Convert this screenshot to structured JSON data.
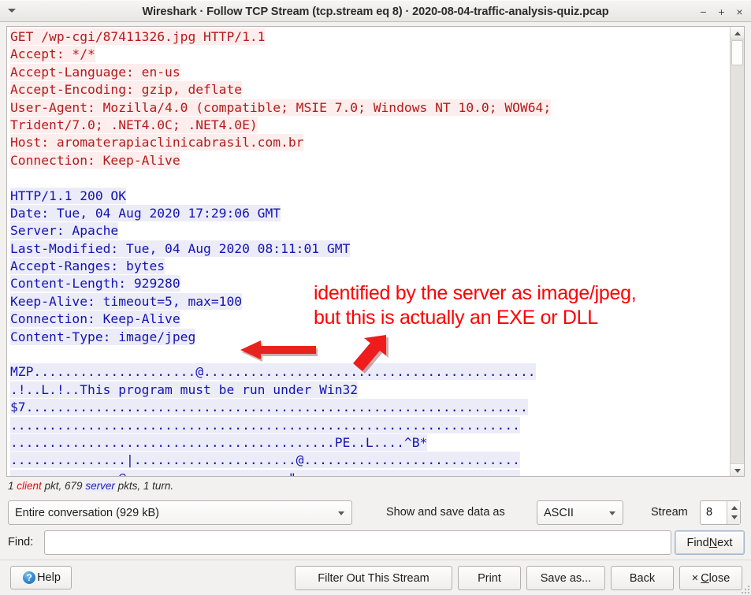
{
  "window": {
    "title": "Wireshark · Follow TCP Stream (tcp.stream eq 8) · 2020-08-04-traffic-analysis-quiz.pcap",
    "menu_arrow_icon": "chevron-down-icon",
    "minimize_label": "−",
    "maximize_label": "+",
    "close_label": "×"
  },
  "stream": {
    "lines": [
      {
        "dir": "client",
        "text": "GET /wp-cgi/87411326.jpg HTTP/1.1"
      },
      {
        "dir": "client",
        "text": "Accept: */*"
      },
      {
        "dir": "client",
        "text": "Accept-Language: en-us"
      },
      {
        "dir": "client",
        "text": "Accept-Encoding: gzip, deflate"
      },
      {
        "dir": "client",
        "text": "User-Agent: Mozilla/4.0 (compatible; MSIE 7.0; Windows NT 10.0; WOW64;"
      },
      {
        "dir": "client",
        "text": "Trident/7.0; .NET4.0C; .NET4.0E)"
      },
      {
        "dir": "client",
        "text": "Host: aromaterapiaclinicabrasil.com.br"
      },
      {
        "dir": "client",
        "text": "Connection: Keep-Alive"
      },
      {
        "dir": "blank",
        "text": ""
      },
      {
        "dir": "server",
        "text": "HTTP/1.1 200 OK"
      },
      {
        "dir": "server",
        "text": "Date: Tue, 04 Aug 2020 17:29:06 GMT"
      },
      {
        "dir": "server",
        "text": "Server: Apache"
      },
      {
        "dir": "server",
        "text": "Last-Modified: Tue, 04 Aug 2020 08:11:01 GMT"
      },
      {
        "dir": "server",
        "text": "Accept-Ranges: bytes"
      },
      {
        "dir": "server",
        "text": "Content-Length: 929280"
      },
      {
        "dir": "server",
        "text": "Keep-Alive: timeout=5, max=100"
      },
      {
        "dir": "server",
        "text": "Connection: Keep-Alive"
      },
      {
        "dir": "server",
        "text": "Content-Type: image/jpeg"
      },
      {
        "dir": "blank",
        "text": ""
      },
      {
        "dir": "server",
        "text": "MZP.....................@..........................................."
      },
      {
        "dir": "server",
        "text": ".!..L.!..This program must be run under Win32"
      },
      {
        "dir": "server",
        "text": "$7................................................................."
      },
      {
        "dir": "server",
        "text": ".................................................................."
      },
      {
        "dir": "server",
        "text": "..........................................PE..L....^B*"
      },
      {
        "dir": "server",
        "text": "...............|.....................@............................"
      },
      {
        "dir": "server",
        "text": "..............@.....................\"............................."
      }
    ]
  },
  "annotation": {
    "line1": "identified by the server as image/jpeg,",
    "line2": "but this is actually an EXE or DLL",
    "color": "#ff0000",
    "arrow_horizontal_icon": "left-arrow-icon",
    "arrow_diagonal_icon": "down-left-arrow-icon"
  },
  "packet_summary": {
    "prefix": "1 ",
    "client_word": "client",
    "middle": " pkt, 679 ",
    "server_word": "server",
    "suffix": " pkts, 1 turn."
  },
  "controls": {
    "conversation_value": "Entire conversation (929 kB)",
    "show_save_label": "Show and save data as",
    "format_value": "ASCII",
    "stream_label": "Stream",
    "stream_value": "8"
  },
  "find": {
    "label": "Find:",
    "value": "",
    "placeholder": "",
    "button_before": "Find ",
    "button_accel": "N",
    "button_after": "ext"
  },
  "buttons": {
    "help": "Help",
    "help_icon_glyph": "?",
    "filter_out": "Filter Out This Stream",
    "print": "Print",
    "save_as": "Save as...",
    "back": "Back",
    "close_mark": "×",
    "close_accel": "C",
    "close_after": "lose"
  },
  "scrollbar": {
    "up_icon": "caret-up-icon",
    "down_icon": "caret-down-icon",
    "thumb": "scroll-thumb"
  }
}
